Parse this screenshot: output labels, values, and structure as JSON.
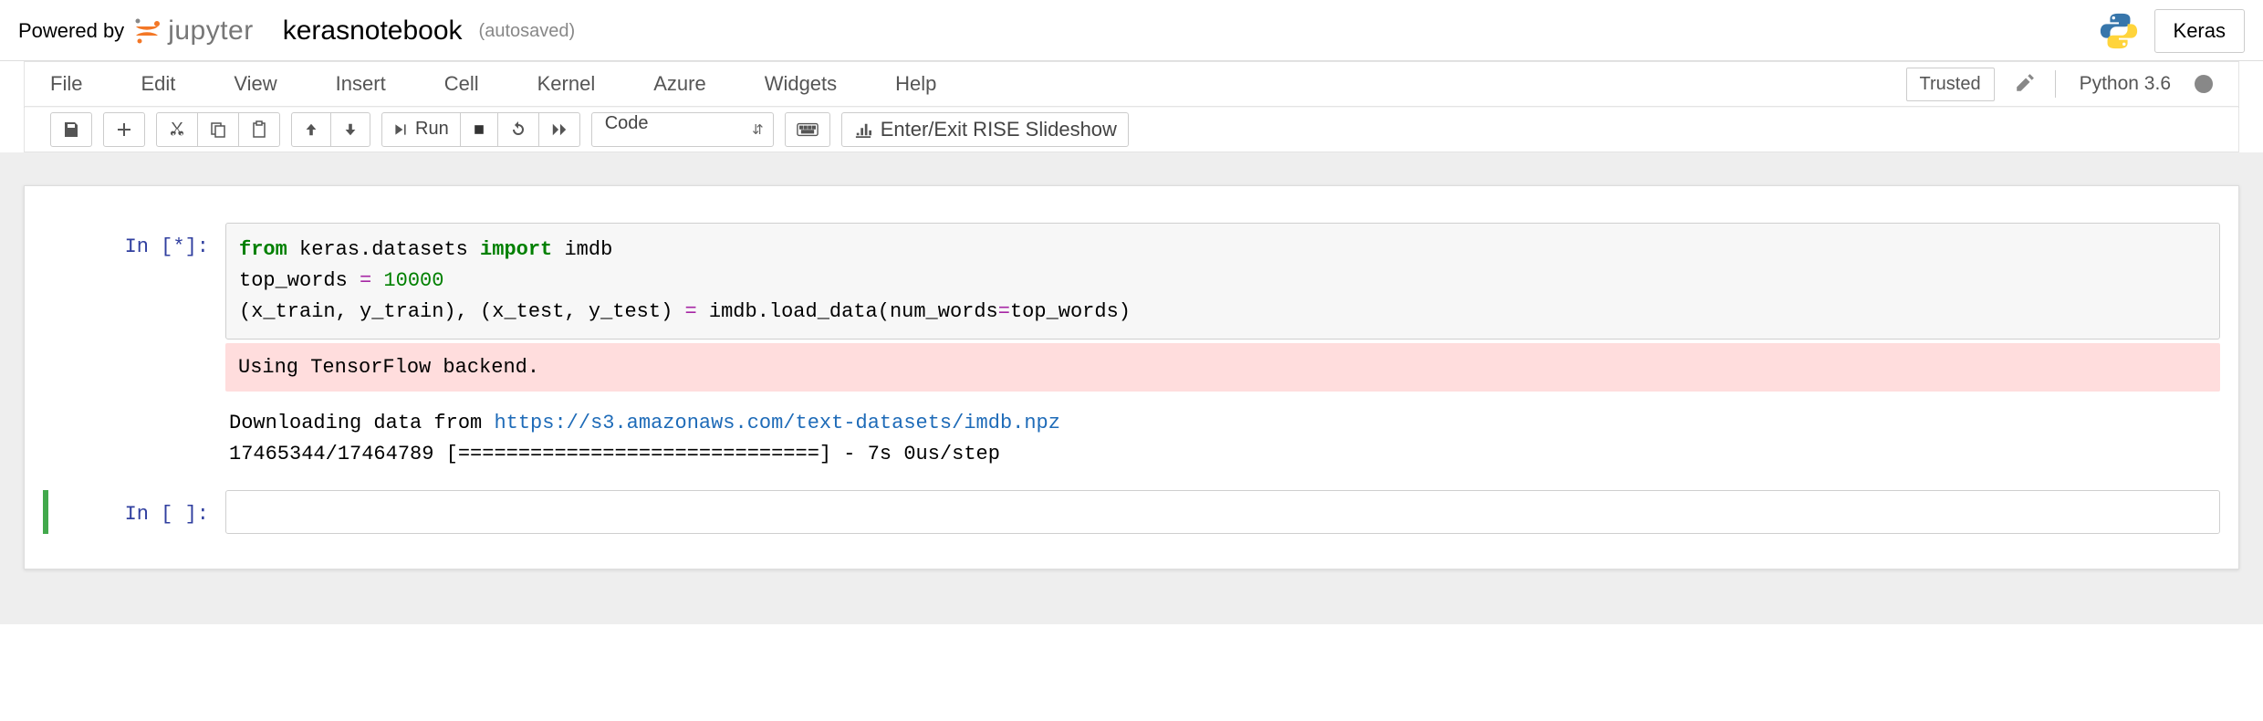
{
  "header": {
    "powered_by": "Powered by",
    "jupyter_label": "jupyter",
    "notebook_name": "kerasnotebook",
    "autosave": "(autosaved)",
    "keras_btn": "Keras"
  },
  "menubar": {
    "items": [
      "File",
      "Edit",
      "View",
      "Insert",
      "Cell",
      "Kernel",
      "Azure",
      "Widgets",
      "Help"
    ],
    "trusted": "Trusted",
    "kernel_name": "Python 3.6"
  },
  "toolbar": {
    "run_label": "Run",
    "cell_type": "Code",
    "rise_btn": "Enter/Exit RISE Slideshow"
  },
  "cells": [
    {
      "prompt": "In [*]:",
      "code": {
        "l1_pre": "from",
        "l1_mid": " keras.datasets ",
        "l1_imp": "import",
        "l1_post": " imdb",
        "l2_name": "top_words ",
        "l2_eq": "=",
        "l2_num": " 10000",
        "l3_a": "(x_train, y_train), (x_test, y_test) ",
        "l3_eq": "=",
        "l3_b": " imdb.load_data",
        "l3_paren_o": "(",
        "l3_arg": "num_words",
        "l3_argeq": "=",
        "l3_argv": "top_words",
        "l3_paren_c": ")"
      },
      "stderr": "Using TensorFlow backend.",
      "stdout_pre": "Downloading data from ",
      "stdout_url": "https://s3.amazonaws.com/text-datasets/imdb.npz",
      "stdout_line2": "17465344/17464789 [==============================] - 7s 0us/step"
    },
    {
      "prompt": "In [ ]:"
    }
  ]
}
